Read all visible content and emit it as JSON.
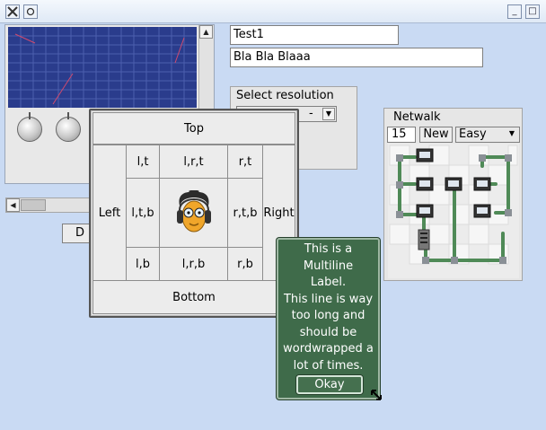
{
  "titlebar": {
    "left_icons": [
      "tools-icon",
      "circle-icon"
    ],
    "minimize_glyph": "_",
    "close_glyph": "□"
  },
  "fields": {
    "text1": "Test1",
    "text2": "Bla Bla Blaaa"
  },
  "resolution": {
    "label": "Select resolution",
    "selected": "- "
  },
  "netwalk": {
    "title": "Netwalk",
    "counter": "15",
    "new_label": "New",
    "difficulty": "Easy"
  },
  "hidden_button_label": "D",
  "panel": {
    "top": "Top",
    "bottom": "Bottom",
    "left": "Left",
    "right": "Right",
    "lt": "l,t",
    "lrt": "l,r,t",
    "rt": "r,t",
    "ltb": "l,t,b",
    "rtb": "r,t,b",
    "lb": "l,b",
    "lrb": "l,r,b",
    "rb": "r,b"
  },
  "tooltip": {
    "lines": [
      "This is a",
      "Multiline",
      "Label.",
      "This line is way",
      "too long and",
      "should be",
      "wordwrapped a",
      "lot of times."
    ],
    "okay_label": "Okay"
  },
  "colors": {
    "background": "#c9daf3",
    "graph": "#2a3c8c",
    "tooltip": "#3f6b4a"
  }
}
